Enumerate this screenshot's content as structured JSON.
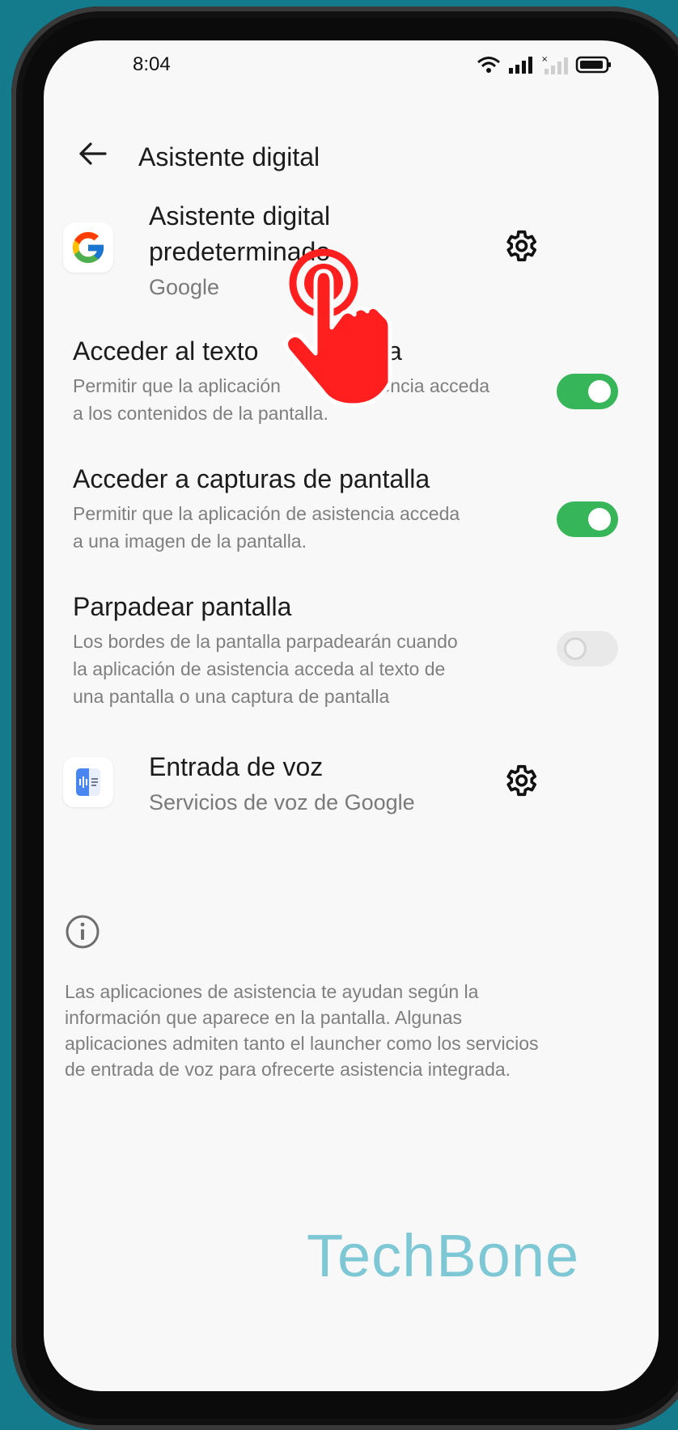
{
  "status_bar": {
    "time": "8:04"
  },
  "header": {
    "title": "Asistente digital"
  },
  "default_assistant": {
    "title_line1": "Asistente digital",
    "title_line2": "predeterminado",
    "subtitle": "Google"
  },
  "screen_text": {
    "title": "Acceder al texto de la pantalla",
    "title_visible_left": "Acceder al texto",
    "title_visible_right": "alla",
    "desc_line1_left": "Permitir que la aplicación",
    "desc_line1_right": "sistencia acceda",
    "desc_line2": "a los contenidos de la pantalla.",
    "enabled": true
  },
  "screenshots": {
    "title": "Acceder a capturas de pantalla",
    "desc_line1": "Permitir que la aplicación de asistencia acceda",
    "desc_line2": "a una imagen de la pantalla.",
    "enabled": true
  },
  "flash_screen": {
    "title": "Parpadear pantalla",
    "desc_line1": "Los bordes de la pantalla parpadearán cuando",
    "desc_line2": "la aplicación de asistencia acceda al texto de",
    "desc_line3": "una pantalla o una captura de pantalla",
    "enabled": false
  },
  "voice_input": {
    "title": "Entrada de voz",
    "subtitle": "Servicios de voz de Google"
  },
  "footer": {
    "line1": "Las aplicaciones de asistencia te ayudan según la",
    "line2": "información que aparece en la pantalla. Algunas",
    "line3": "aplicaciones admiten tanto el launcher como los servicios",
    "line4": "de entrada de voz para ofrecerte asistencia integrada."
  },
  "watermark": "TechBone",
  "colors": {
    "accent": "#37b559",
    "background": "#137b8c",
    "tap": "#ff1f1f"
  }
}
